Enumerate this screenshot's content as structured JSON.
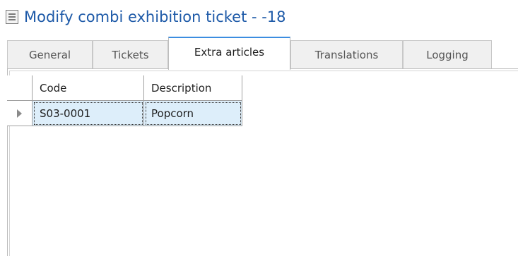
{
  "window": {
    "title": "Modify combi exhibition ticket  - -18",
    "title_icon": "document-icon"
  },
  "tabs": [
    {
      "label": "General",
      "active": false
    },
    {
      "label": "Tickets",
      "active": false
    },
    {
      "label": "Extra articles",
      "active": true
    },
    {
      "label": "Translations",
      "active": false
    },
    {
      "label": "Logging",
      "active": false
    }
  ],
  "grid": {
    "columns": [
      "Code",
      "Description"
    ],
    "rows": [
      {
        "code": "S03-0001",
        "description": "Popcorn",
        "current": true
      }
    ]
  },
  "colors": {
    "title": "#1e5aa8",
    "active_tab_accent": "#3c8de0",
    "selected_row": "#ddeefa"
  }
}
